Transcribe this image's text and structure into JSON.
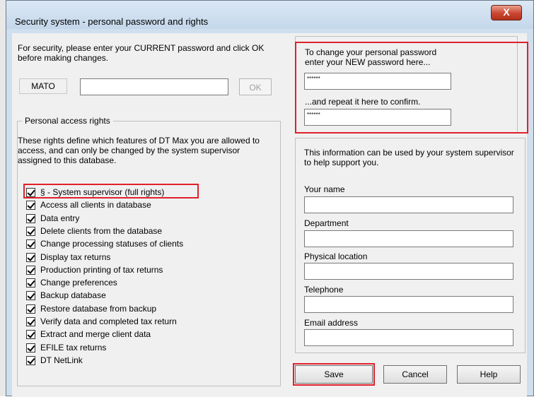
{
  "window": {
    "title": "Security system - personal password and rights",
    "close_glyph": "X"
  },
  "current": {
    "instruction": "For security, please enter your CURRENT password and click OK before making changes.",
    "user_label": "MATO",
    "password_value": "",
    "ok_label": "OK"
  },
  "rights": {
    "group_label": "Personal access rights",
    "description": "These rights define which features of DT Max you are allowed to access, and can only be changed by the system supervisor assigned to this database.",
    "items": [
      {
        "label": "§ - System supervisor (full rights)",
        "checked": true
      },
      {
        "label": "Access all clients in database",
        "checked": true
      },
      {
        "label": "Data entry",
        "checked": true
      },
      {
        "label": "Delete clients from the database",
        "checked": true
      },
      {
        "label": "Change processing statuses of clients",
        "checked": true
      },
      {
        "label": "Display tax returns",
        "checked": true
      },
      {
        "label": "Production printing of tax returns",
        "checked": true
      },
      {
        "label": "Change preferences",
        "checked": true
      },
      {
        "label": "Backup database",
        "checked": true
      },
      {
        "label": "Restore database from backup",
        "checked": true
      },
      {
        "label": "Verify data and completed tax return",
        "checked": true
      },
      {
        "label": "Extract and merge client data",
        "checked": true
      },
      {
        "label": "EFILE tax returns",
        "checked": true
      },
      {
        "label": "DT NetLink",
        "checked": true
      }
    ]
  },
  "newpw": {
    "line1": "To change your personal password",
    "line2": "enter your NEW password here...",
    "new_value": "******",
    "confirm_label": "...and repeat it here to confirm.",
    "confirm_value": "******"
  },
  "info": {
    "description": "This information can be used by your system supervisor to help support you.",
    "fields": {
      "name": {
        "label": "Your name",
        "value": ""
      },
      "department": {
        "label": "Department",
        "value": ""
      },
      "location": {
        "label": "Physical location",
        "value": ""
      },
      "telephone": {
        "label": "Telephone",
        "value": ""
      },
      "email": {
        "label": "Email address",
        "value": ""
      }
    }
  },
  "buttons": {
    "save": "Save",
    "cancel": "Cancel",
    "help": "Help"
  },
  "colors": {
    "highlight": "#e0202c",
    "title_bg": "#cfdfee"
  }
}
